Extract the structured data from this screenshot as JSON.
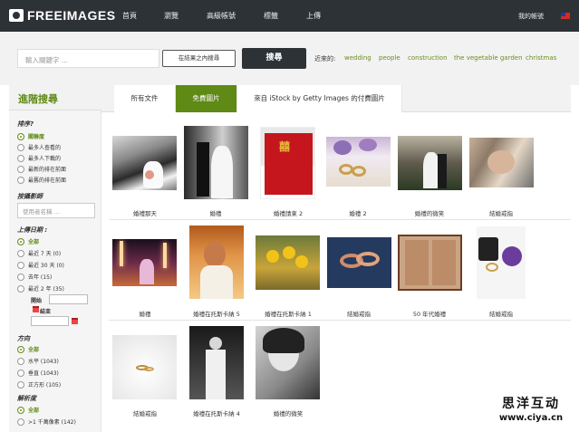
{
  "topbar": {
    "logo": "FREEIMAGES",
    "nav": [
      "首頁",
      "瀏覽",
      "高級帳號",
      "標籤",
      "上傳"
    ],
    "account": "我的帳號",
    "flag": "taiwan-flag-icon"
  },
  "search": {
    "placeholder": "輸入關鍵字 ...",
    "within_label": "在結果之內搜尋",
    "button": "搜尋",
    "recent_label": "近來的:",
    "recent_tags": [
      "wedding",
      "people",
      "construction",
      "the vegetable garden",
      "christmas"
    ]
  },
  "sidebar": {
    "heading": "進階搜尋",
    "sort_title": "排序?",
    "sort_opts": [
      "關聯度",
      "最多人查看的",
      "最多人下載的",
      "最新的排在前面",
      "最舊的排在前面"
    ],
    "author_title": "按攝影師",
    "author_placeholder": "使用者名稱 ...",
    "date_title": "上傳日期 :",
    "date_opts": [
      "全部",
      "最近 7 天 (0)",
      "最近 30 天 (0)",
      "去年 (15)",
      "最近 2 年 (35)"
    ],
    "start_label": "開始",
    "end_label": "結束",
    "orient_title": "方向",
    "orient_opts": [
      "全部",
      "水平 (1043)",
      "垂直 (1043)",
      "正方形 (105)"
    ],
    "res_title": "解析度",
    "res_opts": [
      "全部",
      ">1 千萬像素 (142)"
    ]
  },
  "tabs": [
    "所有文件",
    "免費圖片",
    "來自 iStock by Getty Images 的付費圖片"
  ],
  "captions": [
    "婚禮那天",
    "婚禮",
    "婚禮請柬 2",
    "婚禮 2",
    "婚禮的微笑",
    "結婚戒指",
    "婚禮",
    "婚禮在托斯卡納 5",
    "婚禮在托斯卡納 1",
    "結婚戒指",
    "50 年代婚禮",
    "結婚戒指",
    "結婚戒指",
    "婚禮在托斯卡納 4",
    "婚禮的微笑"
  ],
  "watermark": {
    "line1": "思洋互动",
    "line2": "www.ciya.cn"
  },
  "colors": {
    "accent": "#5e8a15",
    "link": "#6a8f1f",
    "dark": "#2d3237"
  }
}
